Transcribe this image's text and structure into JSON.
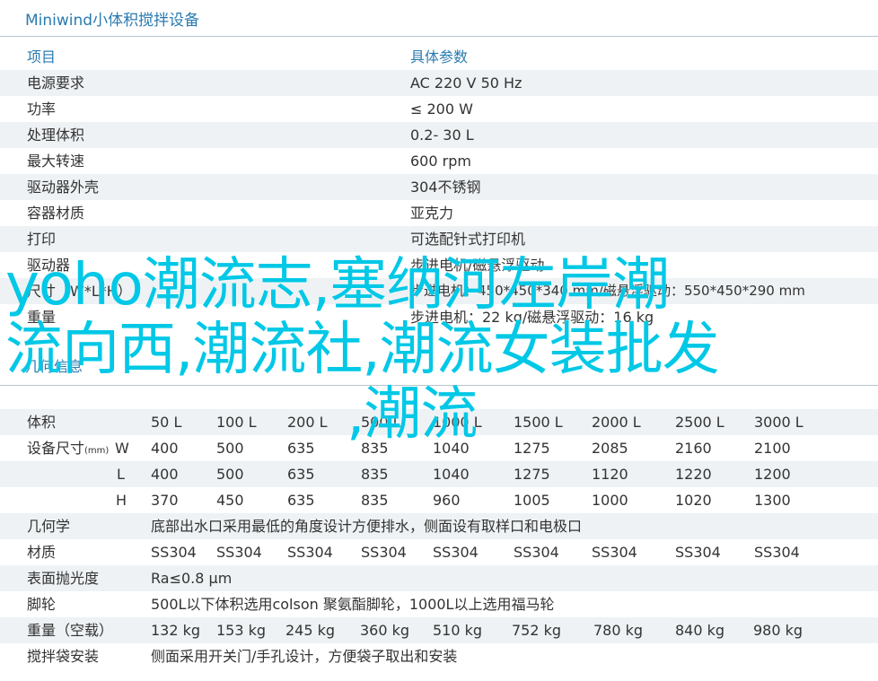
{
  "title": "Miniwind小体积搅拌设备",
  "specs": {
    "header": [
      "项目",
      "具体参数"
    ],
    "rows": [
      [
        "电源要求",
        "AC 220 V 50 Hz"
      ],
      [
        "功率",
        "≤ 200 W"
      ],
      [
        "处理体积",
        "0.2- 30 L"
      ],
      [
        "最大转速",
        "600 rpm"
      ],
      [
        "驱动器外壳",
        "304不锈钢"
      ],
      [
        "容器材质",
        "亚克力"
      ],
      [
        "打印",
        "可选配针式打印机"
      ],
      [
        "驱动器",
        "步进电机/磁悬浮驱动"
      ],
      [
        "尺寸（W*L*H）",
        "步进电机：450*450*340 mm/磁悬浮驱动：550*450*290 mm"
      ],
      [
        "重量",
        "步进电机：22 kg/磁悬浮驱动：16 kg"
      ]
    ]
  },
  "container_section_title": "几何信息",
  "containers": {
    "volume_label": "体积",
    "volumes": [
      "50 L",
      "100 L",
      "200 L",
      "500 L",
      "1000 L",
      "1500 L",
      "2000 L",
      "2500 L",
      "3000 L"
    ],
    "dims_label": "设备尺寸",
    "dims_unit": "(mm)",
    "W_label": "W",
    "L_label": "L",
    "H_label": "H",
    "W": [
      "400",
      "500",
      "635",
      "835",
      "1040",
      "1275",
      "2085",
      "2160",
      "2100"
    ],
    "L": [
      "400",
      "500",
      "635",
      "835",
      "1040",
      "1275",
      "1120",
      "1220",
      "1200"
    ],
    "H": [
      "370",
      "450",
      "635",
      "835",
      "960",
      "1005",
      "1000",
      "1020",
      "1300"
    ],
    "geometry_label": "几何学",
    "geometry_text": "底部出水口采用最低的角度设计方便排水，侧面设有取样口和电极口",
    "material_label": "材质",
    "materials": [
      "SS304",
      "SS304",
      "SS304",
      "SS304",
      "SS304",
      "SS304",
      "SS304",
      "SS304",
      "SS304"
    ],
    "polish_label": "表面抛光度",
    "polish_text": "Ra≤0.8 μm",
    "caster_label": "脚轮",
    "caster_text": "500L以下体积选用colson 聚氨酯脚轮，1000L以上选用福马轮",
    "weight_label": "重量（空载）",
    "weights": [
      "132 kg",
      "153 kg",
      "245 kg",
      "360 kg",
      "510 kg",
      "752 kg",
      "780 kg",
      "840 kg",
      "980 kg"
    ],
    "bag_label": "搅拌袋安装",
    "bag_text": "侧面采用开关门/手孔设计，方便袋子取出和安装"
  },
  "watermark": {
    "line1": "yoho潮流志,塞纳河左岸潮",
    "line2": "流向西,潮流社,潮流女装批发",
    "line3": ",潮流"
  },
  "colors": {
    "accent": "#2a7bb0",
    "shade": "#eef2f4",
    "watermark": "#00c8e6",
    "rule": "#b8c4cc"
  }
}
